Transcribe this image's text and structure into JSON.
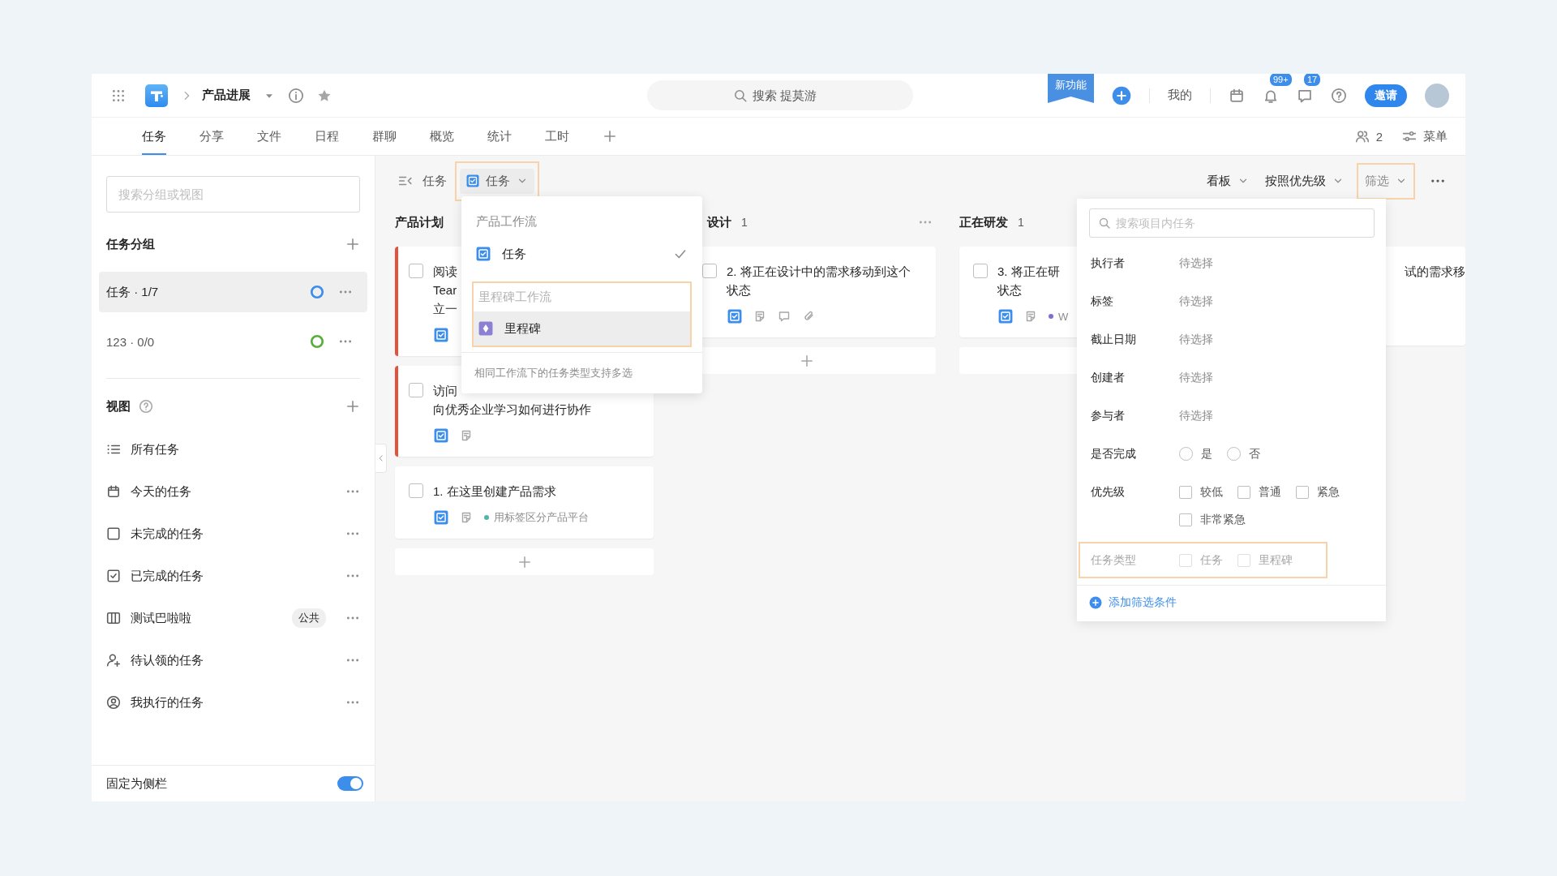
{
  "header": {
    "project": "产品进展",
    "search": {
      "placeholder": "搜索 提莫游"
    },
    "new_feature": "新功能",
    "mine": "我的",
    "notifications": "99+",
    "messages": "17",
    "invite": "邀请"
  },
  "tabs": [
    {
      "label": "任务",
      "selected": true
    },
    {
      "label": "分享",
      "selected": false
    },
    {
      "label": "文件",
      "selected": false
    },
    {
      "label": "日程",
      "selected": false
    },
    {
      "label": "群聊",
      "selected": false
    },
    {
      "label": "概览",
      "selected": false
    },
    {
      "label": "统计",
      "selected": false
    },
    {
      "label": "工时",
      "selected": false
    }
  ],
  "tab_tools": {
    "members": "2",
    "menu": "菜单"
  },
  "sidebar": {
    "search": {
      "placeholder": "搜索分组或视图"
    },
    "groups_title": "任务分组",
    "groups": [
      {
        "label": "任务 · 1/7",
        "selected": true,
        "color": "#3d8eea"
      },
      {
        "label": "123 · 0/0",
        "selected": false,
        "color": "#5aae3c"
      }
    ],
    "views_title": "视图",
    "views": [
      {
        "label": "所有任务",
        "menu": false
      },
      {
        "label": "今天的任务",
        "menu": true
      },
      {
        "label": "未完成的任务",
        "menu": true
      },
      {
        "label": "已完成的任务",
        "menu": true
      },
      {
        "label": "测试巴啦啦",
        "badge": "公共",
        "menu": true
      },
      {
        "label": "待认领的任务",
        "menu": true
      },
      {
        "label": "我执行的任务",
        "menu": true
      }
    ],
    "pin": {
      "label": "固定为侧栏",
      "on": true
    }
  },
  "board": {
    "toolbar": {
      "title": "任务",
      "type_filter": {
        "label": "任务",
        "highlighted": true
      },
      "view": "看板",
      "sort": "按照优先级",
      "filter": {
        "label": "筛选",
        "highlighted": true
      }
    },
    "columns": [
      {
        "title": "产品计划",
        "add_icon": true,
        "cards": [
          {
            "kind": "task",
            "lines": [
              "阅读",
              "Tear",
              "立一"
            ],
            "urgent": true,
            "done": false,
            "note": false,
            "comment": false,
            "attachment": false
          },
          {
            "kind": "task",
            "lines": [
              "访问",
              "向优秀企业学习如何进行协作"
            ],
            "urgent": true,
            "done": false,
            "note": true,
            "comment": false,
            "attachment": false
          },
          {
            "kind": "task",
            "lines": [
              "1. 在这里创建产品需求"
            ],
            "urgent": false,
            "done": false,
            "note": true,
            "comment": false,
            "attachment": false,
            "tag": {
              "text": "用标签区分产品平台",
              "color": "#4fb7a7"
            }
          }
        ]
      },
      {
        "title": "设计",
        "count": "1",
        "menu": true,
        "add_icon": true,
        "cards": [
          {
            "kind": "task",
            "lines": [
              "2. 将正在设计中的需求移动到这个",
              "状态"
            ],
            "urgent": false,
            "done": false,
            "note": true,
            "comment": true,
            "attachment": true
          }
        ]
      },
      {
        "title": "正在研发",
        "count": "1",
        "add_icon": false,
        "cards": [
          {
            "kind": "task",
            "lines": [
              "3. 将正在研",
              "状态"
            ],
            "urgent": false,
            "done": false,
            "note": true,
            "comment": false,
            "attachment": false,
            "tag": {
              "text": "W",
              "color": "#7b6fd0"
            }
          }
        ]
      },
      {
        "cards": [
          {
            "kind": "partial",
            "lines": [
              "试的需求移"
            ]
          }
        ]
      }
    ]
  },
  "type_menu": {
    "groups": [
      {
        "title": "产品工作流",
        "highlighted": false,
        "items": [
          {
            "label": "任务",
            "kind": "task",
            "checked": true,
            "hover": false
          }
        ]
      },
      {
        "title": "里程碑工作流",
        "highlighted": true,
        "items": [
          {
            "label": "里程碑",
            "kind": "milestone",
            "checked": false,
            "hover": true
          }
        ]
      }
    ],
    "hint": "相同工作流下的任务类型支持多选"
  },
  "filter_panel": {
    "search": {
      "placeholder": "搜索项目内任务"
    },
    "rows": [
      {
        "kind": "picker",
        "label": "执行者",
        "value": "待选择"
      },
      {
        "kind": "picker",
        "label": "标签",
        "value": "待选择"
      },
      {
        "kind": "picker",
        "label": "截止日期",
        "value": "待选择"
      },
      {
        "kind": "picker",
        "label": "创建者",
        "value": "待选择"
      },
      {
        "kind": "picker",
        "label": "参与者",
        "value": "待选择"
      },
      {
        "kind": "radio",
        "label": "是否完成",
        "options": [
          {
            "label": "是",
            "selected": false
          },
          {
            "label": "否",
            "selected": false
          }
        ]
      },
      {
        "kind": "checkbox",
        "label": "优先级",
        "options": [
          {
            "label": "较低",
            "checked": false
          },
          {
            "label": "普通",
            "checked": false
          },
          {
            "label": "紧急",
            "checked": false
          },
          {
            "label": "非常紧急",
            "checked": false
          }
        ]
      },
      {
        "kind": "checkbox",
        "label": "任务类型",
        "disabled": true,
        "highlighted": true,
        "options": [
          {
            "label": "任务",
            "checked": false
          },
          {
            "label": "里程碑",
            "checked": false
          }
        ]
      }
    ],
    "add": "添加筛选条件"
  }
}
